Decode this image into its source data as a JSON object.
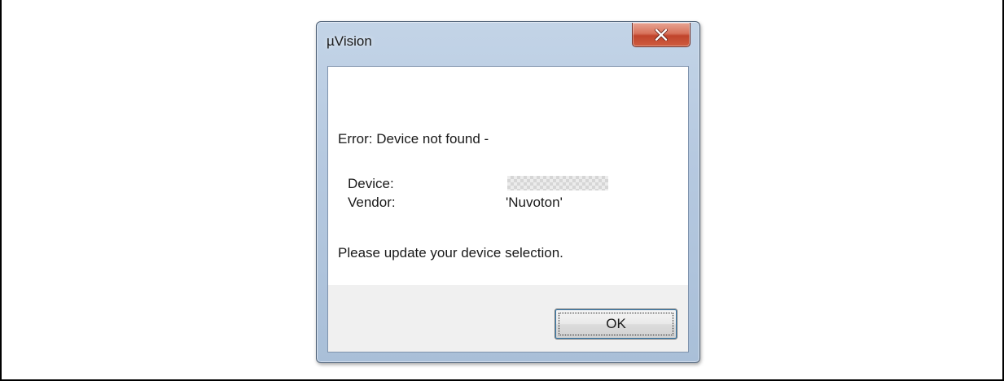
{
  "window": {
    "title": "µVision",
    "close_icon": "close-x-icon"
  },
  "message": {
    "error_line": "Error: Device not found -",
    "device_label": "Device:",
    "vendor_label": "Vendor:",
    "vendor_value": "'Nuvoton'",
    "update_line": "Please update your device selection."
  },
  "buttons": {
    "ok_label": "OK"
  }
}
